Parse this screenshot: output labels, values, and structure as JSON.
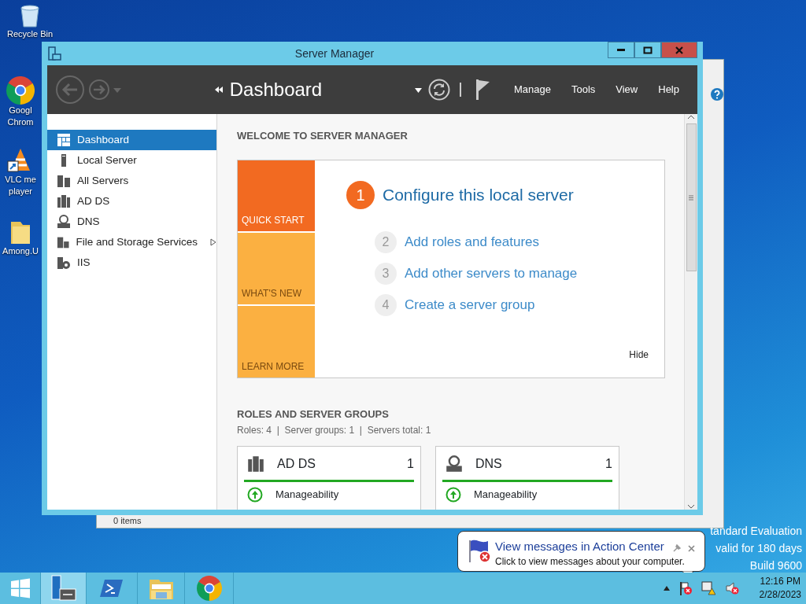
{
  "desktop_icons": [
    {
      "kind": "recycle",
      "label_lines": [
        "Recycle Bin"
      ]
    },
    {
      "kind": "chrome",
      "label_lines": [
        "Googl",
        "Chrom"
      ]
    },
    {
      "kind": "vlc",
      "label_lines": [
        "VLC me",
        "player"
      ]
    },
    {
      "kind": "folder",
      "label_lines": [
        "Among.U"
      ]
    }
  ],
  "back_window": {
    "status_text": "0 items"
  },
  "window": {
    "title": "Server Manager"
  },
  "toolbar": {
    "breadcrumb": "Dashboard",
    "menus": [
      "Manage",
      "Tools",
      "View",
      "Help"
    ]
  },
  "sidebar": {
    "items": [
      {
        "label": "Dashboard",
        "kind": "dashboard",
        "selected": true,
        "has_submenu": false
      },
      {
        "label": "Local Server",
        "kind": "server",
        "selected": false,
        "has_submenu": false
      },
      {
        "label": "All Servers",
        "kind": "servers",
        "selected": false,
        "has_submenu": false
      },
      {
        "label": "AD DS",
        "kind": "adds",
        "selected": false,
        "has_submenu": false
      },
      {
        "label": "DNS",
        "kind": "dns",
        "selected": false,
        "has_submenu": false
      },
      {
        "label": "File and Storage Services",
        "kind": "files",
        "selected": false,
        "has_submenu": true
      },
      {
        "label": "IIS",
        "kind": "iis",
        "selected": false,
        "has_submenu": false
      }
    ]
  },
  "welcome": {
    "heading": "WELCOME TO SERVER MANAGER",
    "tiles": [
      {
        "label": "QUICK START",
        "color": "#f26a21"
      },
      {
        "label": "WHAT'S NEW",
        "color": "#fbb041"
      },
      {
        "label": "LEARN MORE",
        "color": "#fbb041"
      }
    ],
    "steps": [
      {
        "number": "1",
        "label": "Configure this local server",
        "highlighted": true
      },
      {
        "number": "2",
        "label": "Add roles and features",
        "highlighted": false
      },
      {
        "number": "3",
        "label": "Add other servers to manage",
        "highlighted": false
      },
      {
        "number": "4",
        "label": "Create a server group",
        "highlighted": false
      }
    ],
    "hide": "Hide"
  },
  "roles": {
    "heading": "ROLES AND SERVER GROUPS",
    "summary": "Roles: 4  |  Server groups: 1  |  Servers total: 1",
    "cards": [
      {
        "title": "AD DS",
        "kind": "adds",
        "count": "1",
        "status": "Manageability"
      },
      {
        "title": "DNS",
        "kind": "dns",
        "count": "1",
        "status": "Manageability"
      }
    ]
  },
  "edition_lines": [
    "tandard Evaluation",
    "valid for 180 days",
    "Build 9600"
  ],
  "notification": {
    "title": "View messages in Action Center",
    "body": "Click to view messages about your computer."
  },
  "taskbar": {
    "apps": [
      {
        "kind": "server-manager",
        "selected": true
      },
      {
        "kind": "powershell",
        "selected": false
      },
      {
        "kind": "explorer",
        "selected": false
      },
      {
        "kind": "chrome",
        "selected": false
      }
    ],
    "time": "12:16 PM",
    "date": "2/28/2023"
  }
}
